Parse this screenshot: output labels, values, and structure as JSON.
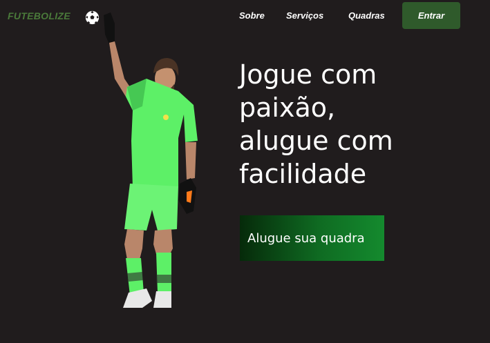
{
  "header": {
    "brand": "FUTEBOLIZE",
    "brand_icon": "soccer-ball-icon",
    "nav": [
      {
        "label": "Sobre"
      },
      {
        "label": "Serviços"
      },
      {
        "label": "Quadras"
      }
    ],
    "login_label": "Entrar"
  },
  "hero": {
    "headline_lines": [
      "Jogue com",
      "paixão,",
      "alugue com",
      "facilidade"
    ],
    "cta_label": "Alugue sua quadra",
    "image": "goalkeeper-photo"
  },
  "colors": {
    "background": "#201c1d",
    "brand": "#4a7a3a",
    "accent_button": "#2f5a2b",
    "cta_gradient_start": "#062a0a",
    "cta_gradient_end": "#148a2e",
    "jersey": "#5df067"
  }
}
